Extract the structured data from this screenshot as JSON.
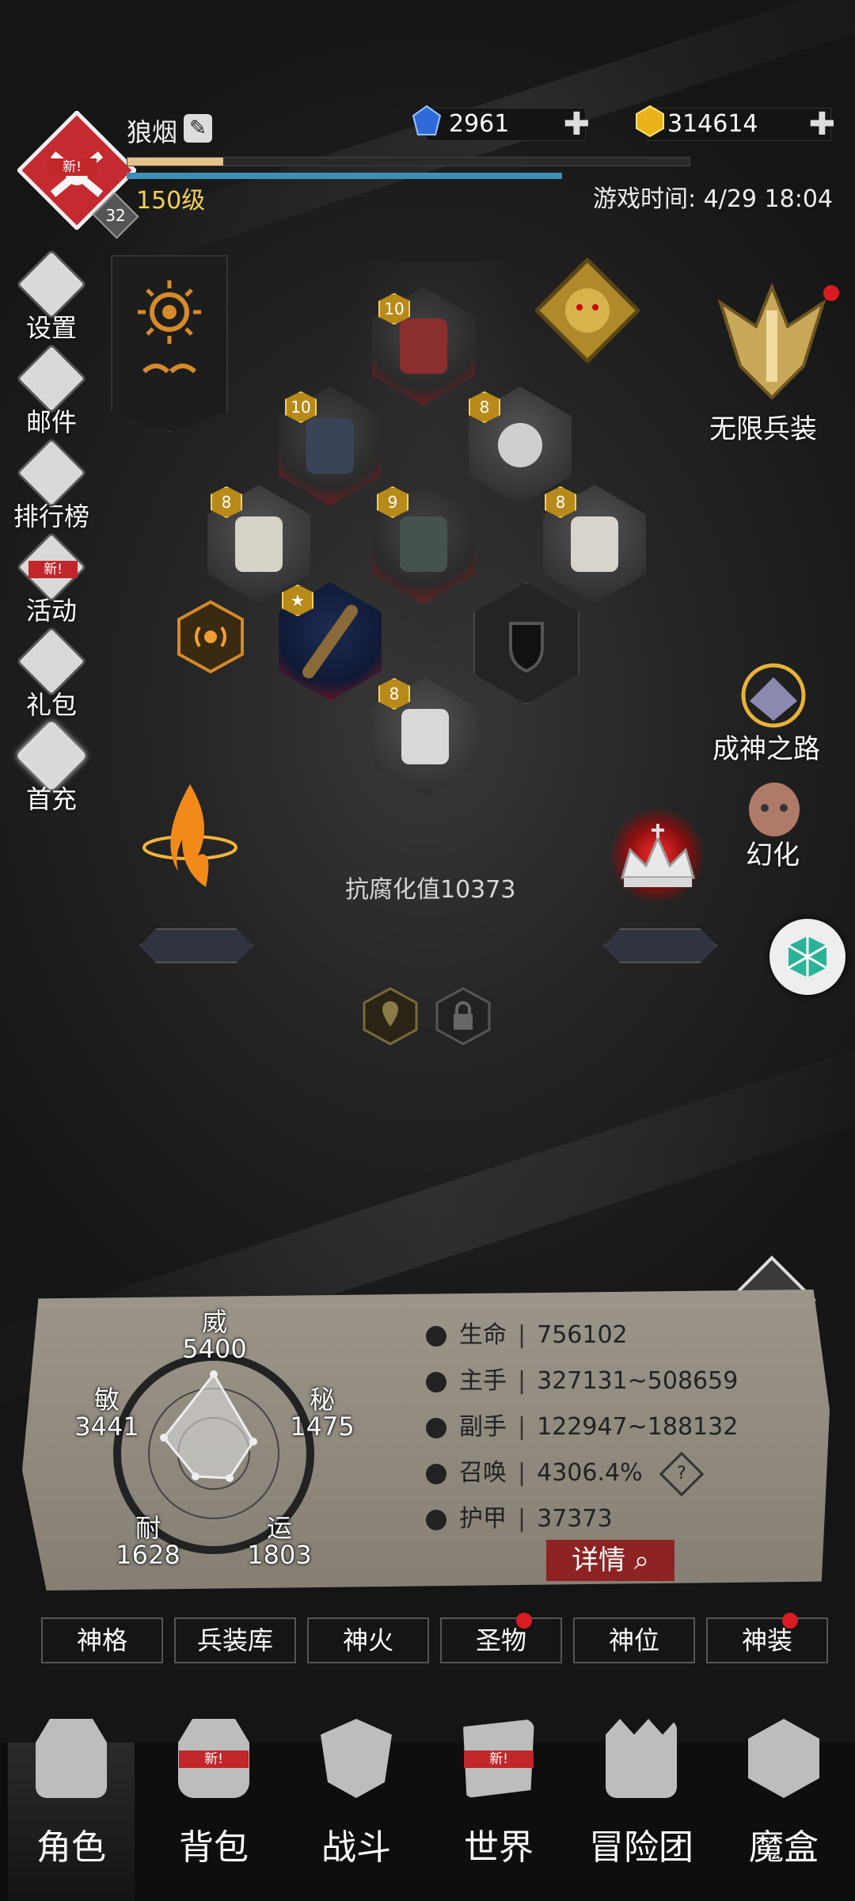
{
  "header": {
    "player_name": "狼烟",
    "level_text": "150级",
    "badge_number": "32",
    "avatar_tag": "新!",
    "xp_percent": 17,
    "gems": "2961",
    "gold": "314614",
    "game_time": "游戏时间: 4/29 18:04"
  },
  "left_menu": [
    {
      "label": "设置",
      "icon": "gear-icon"
    },
    {
      "label": "邮件",
      "icon": "mail-icon"
    },
    {
      "label": "排行榜",
      "icon": "ranking-icon"
    },
    {
      "label": "活动",
      "icon": "event-icon",
      "tag": "新!"
    },
    {
      "label": "礼包",
      "icon": "gift-icon"
    },
    {
      "label": "首充",
      "icon": "first-recharge-icon"
    }
  ],
  "equipment": [
    {
      "slot": "crown",
      "level": "10"
    },
    {
      "slot": "gauntlet",
      "level": "10"
    },
    {
      "slot": "ring",
      "level": "8"
    },
    {
      "slot": "belt",
      "level": "8"
    },
    {
      "slot": "chest",
      "level": "9"
    },
    {
      "slot": "cloak",
      "level": "8"
    },
    {
      "slot": "weapon",
      "level": "★"
    },
    {
      "slot": "boots",
      "level": "8"
    }
  ],
  "right_menu": {
    "infinite_gear": "无限兵装",
    "divine_path": "成神之路",
    "transform": "幻化"
  },
  "corrosion_text": "抗腐化值10373",
  "radar": {
    "wei_label": "威",
    "wei_value": "5400",
    "mi_label": "秘",
    "mi_value": "1475",
    "yun_label": "运",
    "yun_value": "1803",
    "nai_label": "耐",
    "nai_value": "1628",
    "min_label": "敏",
    "min_value": "3441"
  },
  "stats": [
    {
      "label": "生命",
      "value": "756102"
    },
    {
      "label": "主手",
      "value": "327131~508659"
    },
    {
      "label": "副手",
      "value": "122947~188132"
    },
    {
      "label": "召唤",
      "value": "4306.4%"
    },
    {
      "label": "护甲",
      "value": "37373"
    }
  ],
  "details_button": "详情",
  "tabs": [
    "神格",
    "兵装库",
    "神火",
    "圣物",
    "神位",
    "神装"
  ],
  "bottom_nav": [
    {
      "label": "角色",
      "active": true
    },
    {
      "label": "背包",
      "tag": "新!"
    },
    {
      "label": "战斗"
    },
    {
      "label": "世界",
      "tag": "新!"
    },
    {
      "label": "冒险团"
    },
    {
      "label": "魔盒"
    }
  ],
  "colors": {
    "accent_red": "#c0262a",
    "gold": "#f3d25a",
    "panel": "#8f897e"
  }
}
